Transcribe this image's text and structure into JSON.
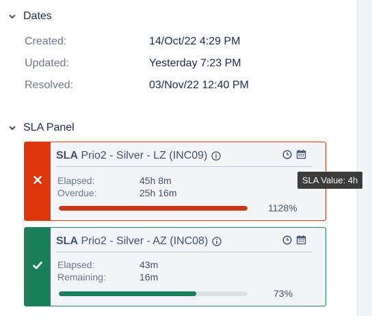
{
  "dates": {
    "title": "Dates",
    "rows": [
      {
        "label": "Created:",
        "value": "14/Oct/22 4:29 PM"
      },
      {
        "label": "Updated:",
        "value": "Yesterday 7:23 PM"
      },
      {
        "label": "Resolved:",
        "value": "03/Nov/22 12:40 PM"
      }
    ]
  },
  "sla_panel": {
    "title": "SLA Panel",
    "cards": [
      {
        "sla_prefix": "SLA",
        "name": " Prio2 - Silver - LZ (INC09)",
        "status": "breached",
        "status_icon": "x-icon",
        "metrics": [
          {
            "label": "Elapsed:",
            "value": "45h 8m"
          },
          {
            "label": "Overdue:",
            "value": "25h 16m"
          }
        ],
        "progress_percent_text": "1128%",
        "progress_fill_fraction": 1.0,
        "colors": {
          "accent": "#de350b",
          "border": "#de350b",
          "bar": "#c9371b"
        }
      },
      {
        "sla_prefix": "SLA",
        "name": " Prio2 - Silver - AZ (INC08)",
        "status": "ok",
        "status_icon": "check-icon",
        "metrics": [
          {
            "label": "Elapsed:",
            "value": "43m"
          },
          {
            "label": "Remaining:",
            "value": "16m"
          }
        ],
        "progress_percent_text": "73%",
        "progress_fill_fraction": 0.73,
        "colors": {
          "accent": "#1a7f5a",
          "border": "#1a7f5a",
          "bar": "#1a7f5a"
        }
      }
    ]
  },
  "tooltip": {
    "text": "SLA Value: 4h"
  },
  "icons": {
    "clock": "clock-icon",
    "calendar": "calendar-icon",
    "info": "info-icon",
    "chevron": "chevron-down-icon"
  }
}
